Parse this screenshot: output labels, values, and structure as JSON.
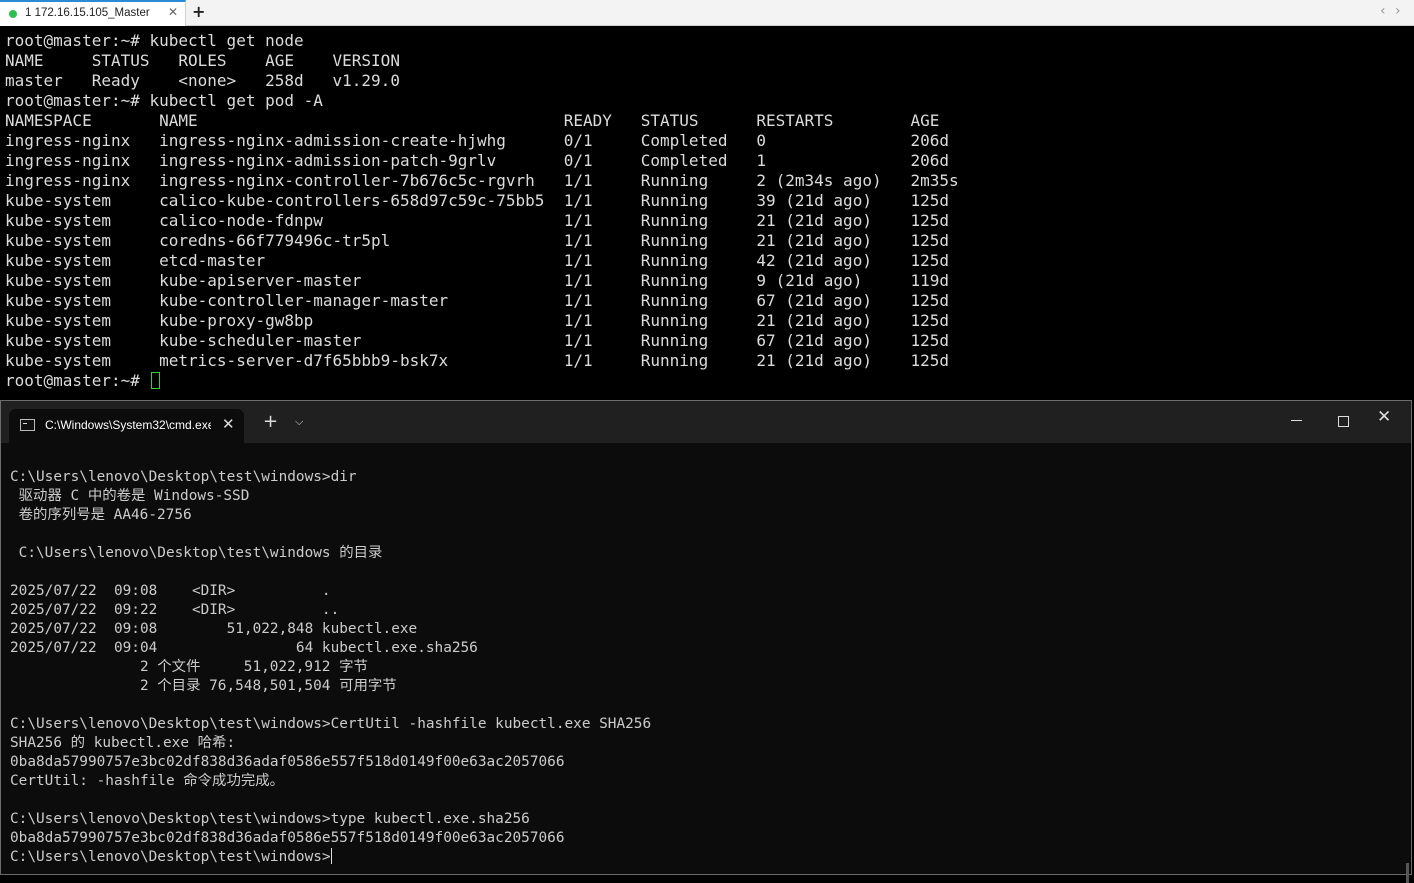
{
  "ssh": {
    "tab": {
      "label": "1 172.16.15.105_Master",
      "status_color": "#2ec04f"
    },
    "new_tab_icon": "plus-icon",
    "terminal": {
      "lines": [
        "root@master:~# kubectl get node",
        "NAME     STATUS   ROLES    AGE    VERSION",
        "master   Ready    <none>   258d   v1.29.0",
        "root@master:~# kubectl get pod -A",
        "NAMESPACE       NAME                                      READY   STATUS      RESTARTS        AGE",
        "ingress-nginx   ingress-nginx-admission-create-hjwhg      0/1     Completed   0               206d",
        "ingress-nginx   ingress-nginx-admission-patch-9grlv       0/1     Completed   1               206d",
        "ingress-nginx   ingress-nginx-controller-7b676c5c-rgvrh   1/1     Running     2 (2m34s ago)   2m35s",
        "kube-system     calico-kube-controllers-658d97c59c-75bb5  1/1     Running     39 (21d ago)    125d",
        "kube-system     calico-node-fdnpw                         1/1     Running     21 (21d ago)    125d",
        "kube-system     coredns-66f779496c-tr5pl                  1/1     Running     21 (21d ago)    125d",
        "kube-system     etcd-master                               1/1     Running     42 (21d ago)    125d",
        "kube-system     kube-apiserver-master                     1/1     Running     9 (21d ago)     119d",
        "kube-system     kube-controller-manager-master            1/1     Running     67 (21d ago)    125d",
        "kube-system     kube-proxy-gw8bp                          1/1     Running     21 (21d ago)    125d",
        "kube-system     kube-scheduler-master                     1/1     Running     67 (21d ago)    125d",
        "kube-system     metrics-server-d7f65bbb9-bsk7x            1/1     Running     21 (21d ago)    125d"
      ],
      "prompt": "root@master:~# "
    }
  },
  "cmd": {
    "tab_title": "C:\\Windows\\System32\\cmd.exe",
    "lines": [
      "",
      "C:\\Users\\lenovo\\Desktop\\test\\windows>dir",
      " 驱动器 C 中的卷是 Windows-SSD",
      " 卷的序列号是 AA46-2756",
      "",
      " C:\\Users\\lenovo\\Desktop\\test\\windows 的目录",
      "",
      "2025/07/22  09:08    <DIR>          .",
      "2025/07/22  09:22    <DIR>          ..",
      "2025/07/22  09:08        51,022,848 kubectl.exe",
      "2025/07/22  09:04                64 kubectl.exe.sha256",
      "               2 个文件     51,022,912 字节",
      "               2 个目录 76,548,501,504 可用字节",
      "",
      "C:\\Users\\lenovo\\Desktop\\test\\windows>CertUtil -hashfile kubectl.exe SHA256",
      "SHA256 的 kubectl.exe 哈希:",
      "0ba8da57990757e3bc02df838d36adaf0586e557f518d0149f00e63ac2057066",
      "CertUtil: -hashfile 命令成功完成。",
      "",
      "C:\\Users\\lenovo\\Desktop\\test\\windows>type kubectl.exe.sha256",
      "0ba8da57990757e3bc02df838d36adaf0586e557f518d0149f00e63ac2057066"
    ],
    "prompt": "C:\\Users\\lenovo\\Desktop\\test\\windows>",
    "icons": [
      "cmd-icon",
      "close-icon",
      "plus-icon",
      "chevron-down-icon",
      "minimize-icon",
      "maximize-icon",
      "close-icon"
    ]
  }
}
